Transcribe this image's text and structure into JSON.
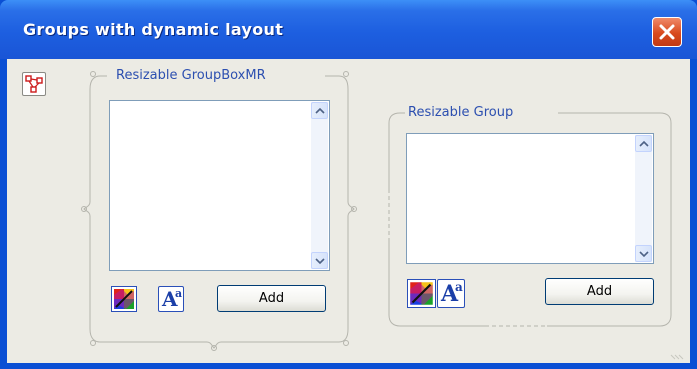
{
  "window": {
    "title": "Groups with dynamic layout"
  },
  "group_mr": {
    "title": "Resizable GroupBoxMR",
    "add_label": "Add"
  },
  "group": {
    "title": "Resizable Group",
    "add_label": "Add"
  },
  "icons": {
    "close": "close-icon",
    "layout": "layout-graph-icon",
    "color": "color-picker-icon",
    "font": "font-icon"
  },
  "colors": {
    "titlebar": "#1d5fe0",
    "close_button": "#d84a1e",
    "client_background": "#ecebe4",
    "group_title": "#2c4fb0"
  }
}
